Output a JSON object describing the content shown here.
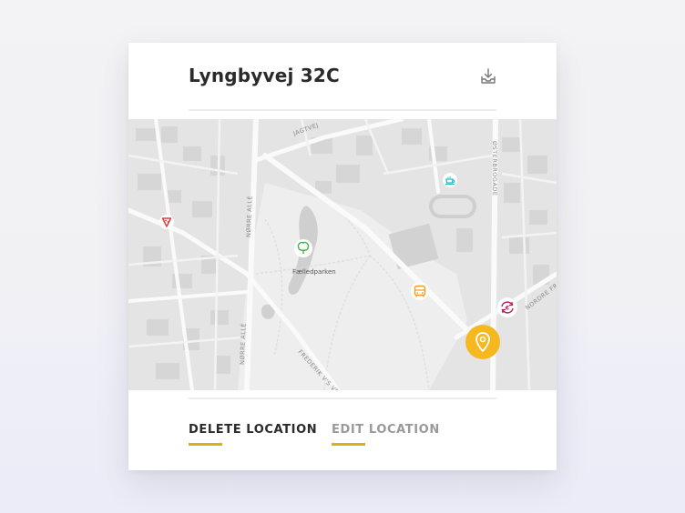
{
  "card": {
    "title": "Lyngbyvej 32C"
  },
  "toolbar": {
    "download_icon": "download-tray-icon"
  },
  "map": {
    "street_labels": {
      "jagtvej": "JAGTVEJ",
      "norre_alle": "NØRRE ALLÉ",
      "osterbrogade": "ØSTERBROGADE",
      "nordre_fr": "NORDRE FR",
      "frederik_vs_vej": "FREDERIK V'S VE"
    },
    "park_label": "Fælledparken",
    "pois": [
      {
        "icon": "pizza-icon",
        "color": "#e53935"
      },
      {
        "icon": "tree-icon",
        "color": "#43b34a"
      },
      {
        "icon": "coffee-icon",
        "color": "#2ab7c9"
      },
      {
        "icon": "bus-icon",
        "color": "#f29a1d"
      },
      {
        "icon": "currency-exchange-icon",
        "color": "#c2185b"
      }
    ],
    "pin": {
      "icon": "location-pin-icon",
      "color": "#f5b820"
    }
  },
  "actions": {
    "delete_label": "DELETE LOCATION",
    "edit_label": "EDIT LOCATION",
    "accent": "#e0ae1c"
  }
}
